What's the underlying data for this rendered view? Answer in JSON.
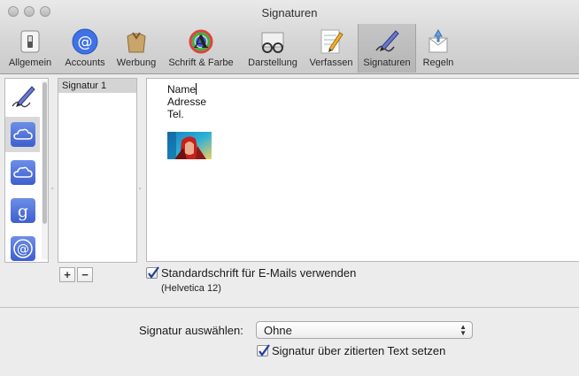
{
  "window": {
    "title": "Signaturen"
  },
  "toolbar": {
    "items": [
      {
        "label": "Allgemein",
        "icon": "switch-icon"
      },
      {
        "label": "Accounts",
        "icon": "at-icon"
      },
      {
        "label": "Werbung",
        "icon": "trash-bag-icon"
      },
      {
        "label": "Schrift & Farbe",
        "icon": "font-color-icon"
      },
      {
        "label": "Darstellung",
        "icon": "glasses-icon"
      },
      {
        "label": "Verfassen",
        "icon": "pencil-icon"
      },
      {
        "label": "Signaturen",
        "icon": "signature-pen-icon",
        "selected": true
      },
      {
        "label": "Regeln",
        "icon": "rules-icon"
      }
    ]
  },
  "accounts": [
    {
      "icon": "signature-pen-icon"
    },
    {
      "icon": "icloud-icon",
      "selected": true
    },
    {
      "icon": "icloud-icon"
    },
    {
      "icon": "google-icon"
    },
    {
      "icon": "at-icon"
    }
  ],
  "signature_list": {
    "items": [
      "Signatur 1"
    ]
  },
  "editor": {
    "lines": [
      "Name",
      "Adresse",
      "Tel."
    ]
  },
  "buttons": {
    "add": "+",
    "remove": "−"
  },
  "default_font": {
    "label": "Standardschrift für E-Mails verwenden",
    "checked": true,
    "note": "(Helvetica 12)"
  },
  "choose_signature": {
    "label": "Signatur auswählen:",
    "value": "Ohne"
  },
  "place_above": {
    "label": "Signatur über zitierten Text setzen",
    "checked": true
  },
  "colors": {
    "accent": "#3d5fcf",
    "checkmark": "#1f3f9e"
  }
}
